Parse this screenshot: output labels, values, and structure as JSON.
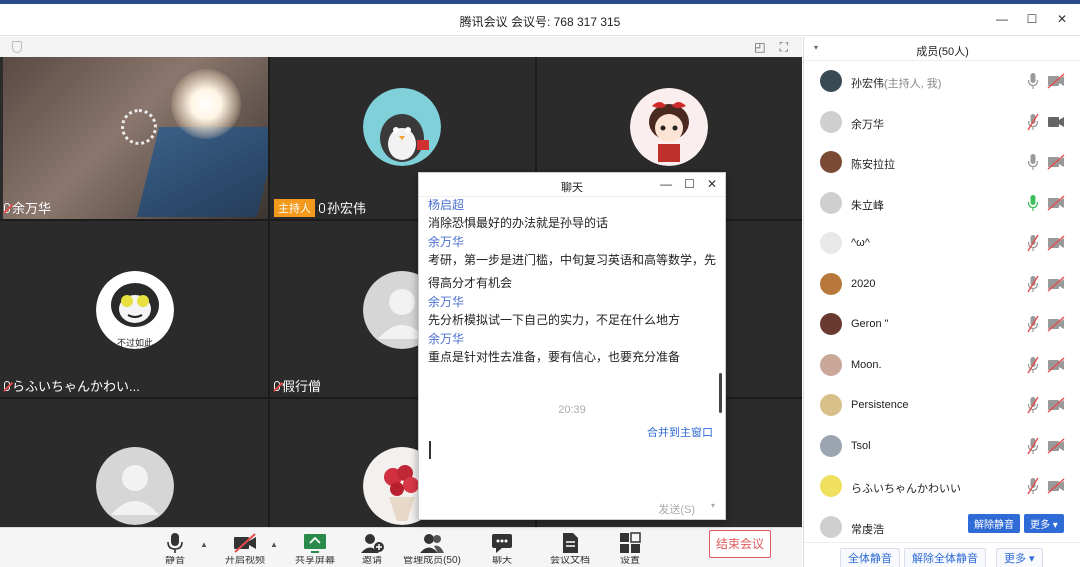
{
  "window": {
    "title": "腾讯会议 会议号: 768 317 315",
    "minimize": "—",
    "maximize": "☐",
    "close": "✕"
  },
  "video_grid": {
    "tiles": [
      {
        "name": "余万华",
        "mic": "off"
      },
      {
        "name": "孙宏伟",
        "host_tag": "主持人",
        "mic": "on"
      },
      {
        "name": "",
        "mic": "none"
      },
      {
        "name": "らふいちゃんかわい...",
        "mic": "off",
        "sticker_text": "不过如此"
      },
      {
        "name": "假行僧",
        "mic": "off"
      },
      {
        "name": "",
        "mic": "none"
      },
      {
        "name": "",
        "mic": "none"
      },
      {
        "name": "",
        "mic": "none"
      },
      {
        "name": "",
        "mic": "none"
      }
    ]
  },
  "toolbar": {
    "items": [
      {
        "label": "静音",
        "icon": "microphone-icon"
      },
      {
        "label": "开启视频",
        "icon": "video-off-icon"
      },
      {
        "label": "共享屏幕",
        "icon": "screen-share-icon"
      },
      {
        "label": "邀请",
        "icon": "invite-icon"
      },
      {
        "label": "管理成员(50)",
        "icon": "members-icon"
      },
      {
        "label": "聊天",
        "icon": "chat-icon"
      },
      {
        "label": "会议文档",
        "icon": "document-icon"
      },
      {
        "label": "设置",
        "icon": "settings-icon"
      }
    ],
    "end_meeting": "结束会议"
  },
  "chat": {
    "title": "聊天",
    "messages": [
      {
        "sender": "杨启超",
        "text": "消除恐惧最好的办法就是孙导的话"
      },
      {
        "sender": "余万华",
        "text": "考研，第一步是进门槛，中旬复习英语和高等数学，先"
      },
      {
        "sender": "",
        "text": "得高分才有机会"
      },
      {
        "sender": "余万华",
        "text": "先分析模拟试一下自己的实力，不足在什么地方"
      },
      {
        "sender": "余万华",
        "text": "重点是针对性去准备，要有信心，也要充分准备"
      }
    ],
    "time": "20:39",
    "merge_label": "合并到主窗口",
    "send_label": "发送(S)",
    "send_drop": "▾"
  },
  "members": {
    "header": "成员(50人)",
    "collapse": "▾",
    "list": [
      {
        "name": "孙宏伟",
        "sub": "(主持人, 我)",
        "mic": "on",
        "cam": "off",
        "avatar_color": "#3a4a55"
      },
      {
        "name": "余万华",
        "sub": "",
        "mic": "off",
        "cam": "on",
        "avatar_color": "#cfcfcf"
      },
      {
        "name": "陈安拉拉",
        "sub": "",
        "mic": "on",
        "cam": "off",
        "avatar_color": "#7a4a35"
      },
      {
        "name": "朱立峰",
        "sub": "",
        "mic": "speaking",
        "cam": "off",
        "avatar_color": "#cfcfcf"
      },
      {
        "name": "^ω^",
        "sub": "",
        "mic": "off",
        "cam": "off",
        "avatar_color": "#e8e8e8"
      },
      {
        "name": "2020",
        "sub": "",
        "mic": "off",
        "cam": "off",
        "avatar_color": "#b8783a"
      },
      {
        "name": "Geron \"",
        "sub": "",
        "mic": "off",
        "cam": "off",
        "avatar_color": "#6a3a30"
      },
      {
        "name": "Moon.",
        "sub": "",
        "mic": "off",
        "cam": "off",
        "avatar_color": "#c9a89a"
      },
      {
        "name": "Persistence",
        "sub": "",
        "mic": "off",
        "cam": "off",
        "avatar_color": "#d8c08a"
      },
      {
        "name": "Tsol",
        "sub": "",
        "mic": "off",
        "cam": "off",
        "avatar_color": "#9aa5b0"
      },
      {
        "name": "らふいちゃんかわいい",
        "sub": "",
        "mic": "off",
        "cam": "off",
        "avatar_color": "#f0e060"
      },
      {
        "name": "常虔浩",
        "sub": "",
        "mic": "buttons",
        "cam": "none",
        "avatar_color": "#cfcfcf"
      }
    ],
    "row_unmute": "解除静音",
    "row_more": "更多 ▾",
    "footer": {
      "mute_all": "全体静音",
      "unmute_all": "解除全体静音",
      "more": "更多 ▾"
    }
  },
  "colors": {
    "accent": "#2f6bd6",
    "end": "#e05b5b",
    "mute_red": "#e54b4b",
    "speaking_green": "#3cbf5a",
    "host_tag": "#f39a1c"
  }
}
